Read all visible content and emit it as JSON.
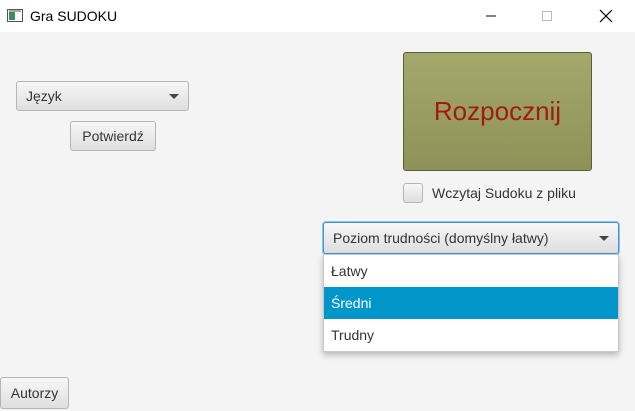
{
  "window": {
    "title": "Gra SUDOKU",
    "controls": {
      "minimize": "minimize-icon",
      "maximize": "maximize-icon",
      "close": "close-icon"
    }
  },
  "language": {
    "combo_value": "Język",
    "confirm_label": "Potwierdź"
  },
  "game": {
    "start_label": "Rozpocznij",
    "load_from_file_label": "Wczytaj Sudoku z pliku",
    "load_from_file_checked": false
  },
  "difficulty": {
    "combo_value": "Poziom trudności (domyślny łatwy)",
    "options": [
      "Łatwy",
      "Średni",
      "Trudny"
    ],
    "highlighted": "Średni"
  },
  "authors_label": "Autorzy",
  "colors": {
    "start_button": "#9a9d61",
    "start_text": "#a11b12",
    "selection": "#0096c9",
    "focus_border": "#3c97d6"
  }
}
